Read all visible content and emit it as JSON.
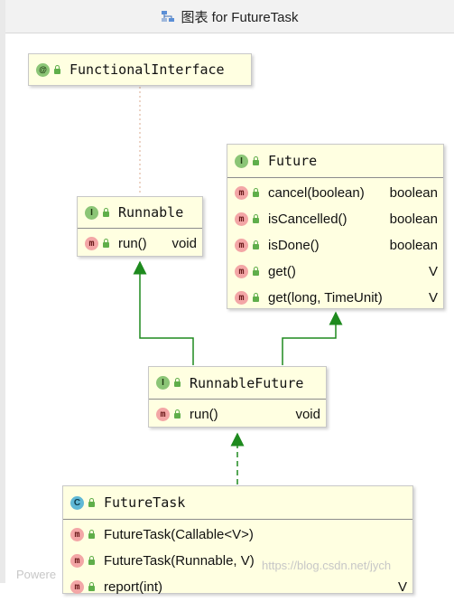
{
  "window": {
    "title": "图表 for FutureTask"
  },
  "nodes": {
    "functional_interface": {
      "badge": "@",
      "name": "FunctionalInterface"
    },
    "runnable": {
      "badge": "I",
      "name": "Runnable",
      "members": [
        {
          "badge": "m",
          "name": "run()",
          "type": "void"
        }
      ]
    },
    "future": {
      "badge": "I",
      "name": "Future",
      "members": [
        {
          "badge": "m",
          "name": "cancel(boolean)",
          "type": "boolean"
        },
        {
          "badge": "m",
          "name": "isCancelled()",
          "type": "boolean"
        },
        {
          "badge": "m",
          "name": "isDone()",
          "type": "boolean"
        },
        {
          "badge": "m",
          "name": "get()",
          "type": "V"
        },
        {
          "badge": "m",
          "name": "get(long, TimeUnit)",
          "type": "V"
        }
      ]
    },
    "runnable_future": {
      "badge": "I",
      "name": "RunnableFuture",
      "members": [
        {
          "badge": "m",
          "name": "run()",
          "type": "void"
        }
      ]
    },
    "future_task": {
      "badge": "C",
      "name": "FutureTask",
      "members": [
        {
          "badge": "m",
          "name": "FutureTask(Callable<V>)",
          "type": ""
        },
        {
          "badge": "m",
          "name": "FutureTask(Runnable, V)",
          "type": ""
        },
        {
          "badge": "m",
          "name": "report(int)",
          "type": "V"
        }
      ]
    }
  },
  "edges": [
    {
      "from": "runnable",
      "to": "functional_interface",
      "style": "dotted"
    },
    {
      "from": "runnable_future",
      "to": "runnable",
      "style": "solid-arrow"
    },
    {
      "from": "runnable_future",
      "to": "future",
      "style": "solid-arrow"
    },
    {
      "from": "future_task",
      "to": "runnable_future",
      "style": "dashed-arrow"
    }
  ],
  "colors": {
    "node_fill": "#ffffe1",
    "edge": "#1e8a1e",
    "interface_badge": "#8bc576",
    "class_badge": "#5fb8d6",
    "method_badge": "#f3a6a6"
  },
  "watermarks": {
    "left": "Powere",
    "right": "https://blog.csdn.net/jych"
  }
}
